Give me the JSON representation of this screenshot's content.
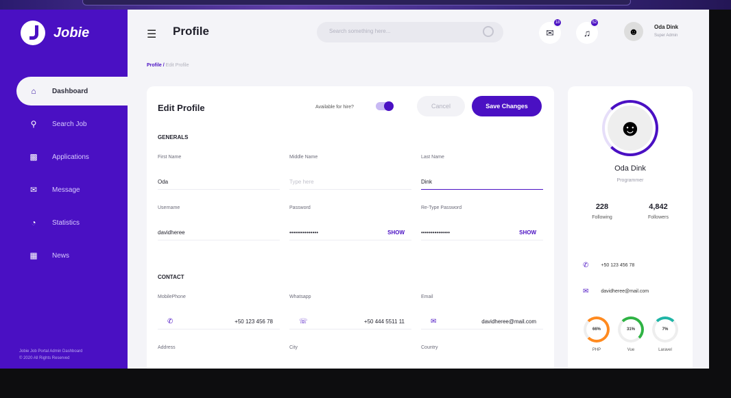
{
  "brand": {
    "name": "Jobie"
  },
  "sidebar": {
    "items": [
      {
        "label": "Dashboard",
        "icon": "home-icon"
      },
      {
        "label": "Search Job",
        "icon": "search-icon"
      },
      {
        "label": "Applications",
        "icon": "puzzle-icon"
      },
      {
        "label": "Message",
        "icon": "chat-icon"
      },
      {
        "label": "Statistics",
        "icon": "pie-chart-icon"
      },
      {
        "label": "News",
        "icon": "newspaper-icon"
      }
    ],
    "footer_line1": "Jobie Job Portal Admin Dashboard",
    "footer_line2": "© 2020 All Rights Reserved"
  },
  "header": {
    "title": "Profile",
    "search_placeholder": "Search something here...",
    "messages_badge": "18",
    "notifications_badge": "52",
    "user_name": "Oda Dink",
    "user_role": "Super Admin"
  },
  "breadcrumb": {
    "root": "Profile /",
    "current": "Edit Profile"
  },
  "edit": {
    "title": "Edit Profile",
    "hire_label": "Available for hire?",
    "cancel": "Cancel",
    "save": "Save Changes",
    "generals_title": "GENERALS",
    "first_name_label": "First Name",
    "first_name": "Oda",
    "middle_name_label": "Middle Name",
    "middle_name_placeholder": "Type here",
    "last_name_label": "Last Name",
    "last_name": "Dink",
    "username_label": "Username",
    "username": "davidheree",
    "password_label": "Password",
    "password": "•••••••••••••••",
    "retype_label": "Re-Type Password",
    "retype": "•••••••••••••••",
    "show": "SHOW",
    "contact_title": "CONTACT",
    "mobile_label": "MobilePhone",
    "mobile": "+50 123 456 78",
    "whatsapp_label": "Whatsapp",
    "whatsapp": "+50 444 5511 11",
    "email_label": "Email",
    "email": "davidheree@mail.com",
    "address_label": "Address",
    "city_label": "City",
    "country_label": "Country"
  },
  "profile": {
    "name": "Oda Dink",
    "role": "Programmer",
    "following": "228",
    "following_label": "Following",
    "followers": "4,842",
    "followers_label": "Followers",
    "phone": "+50 123 456 78",
    "email": "davidheree@mail.com",
    "skills": [
      {
        "pct": "66%",
        "label": "PHP",
        "color": "#ff8a1f"
      },
      {
        "pct": "31%",
        "label": "Vue",
        "color": "#2fb344"
      },
      {
        "pct": "7%",
        "label": "Laravel",
        "color": "#1fb5a6"
      }
    ]
  },
  "colors": {
    "accent": "#4a10c3",
    "bg": "#f4f4f8"
  }
}
